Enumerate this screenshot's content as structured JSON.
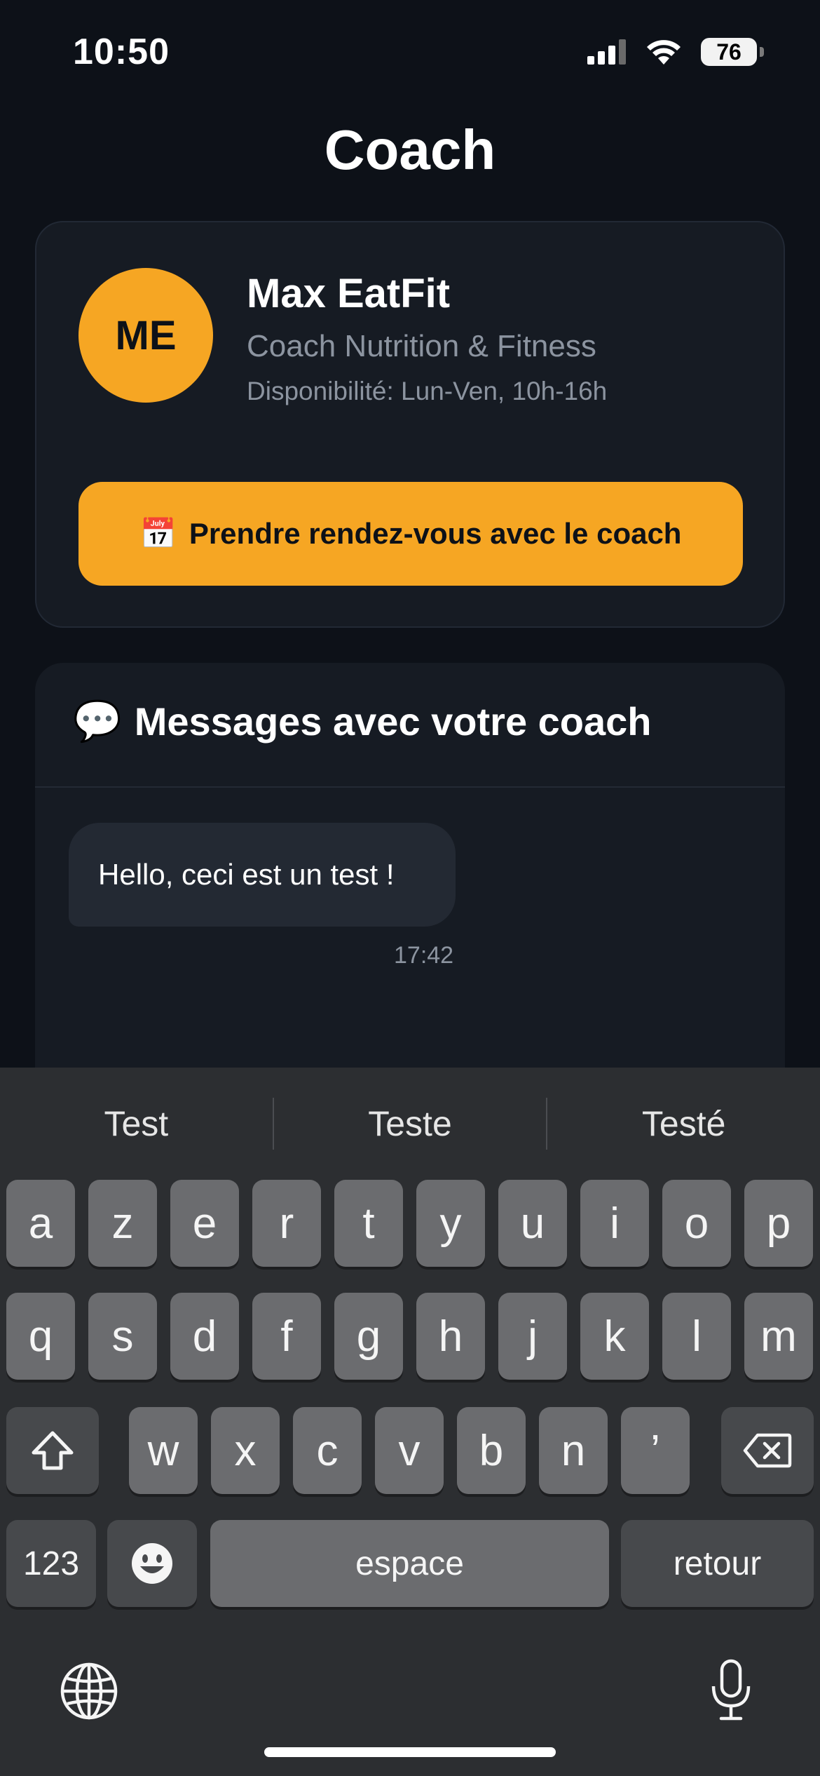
{
  "status_bar": {
    "time": "10:50",
    "battery": "76"
  },
  "page": {
    "title": "Coach"
  },
  "coach": {
    "initials": "ME",
    "name": "Max EatFit",
    "role": "Coach Nutrition & Fitness",
    "availability": "Disponibilité: Lun-Ven, 10h-16h",
    "book_button_label": "Prendre rendez-vous avec le coach",
    "book_button_emoji": "📅",
    "accent_color": "#f6a623"
  },
  "messages": {
    "title": "Messages avec votre coach",
    "title_emoji": "💬",
    "items": [
      {
        "text": "Hello, ceci est un test !",
        "time": "17:42"
      }
    ]
  },
  "keyboard": {
    "suggestions": [
      "Test",
      "Teste",
      "Testé"
    ],
    "row1": [
      "a",
      "z",
      "e",
      "r",
      "t",
      "y",
      "u",
      "i",
      "o",
      "p"
    ],
    "row2": [
      "q",
      "s",
      "d",
      "f",
      "g",
      "h",
      "j",
      "k",
      "l",
      "m"
    ],
    "row3": [
      "w",
      "x",
      "c",
      "v",
      "b",
      "n",
      "’"
    ],
    "numbers_label": "123",
    "space_label": "espace",
    "return_label": "retour"
  }
}
